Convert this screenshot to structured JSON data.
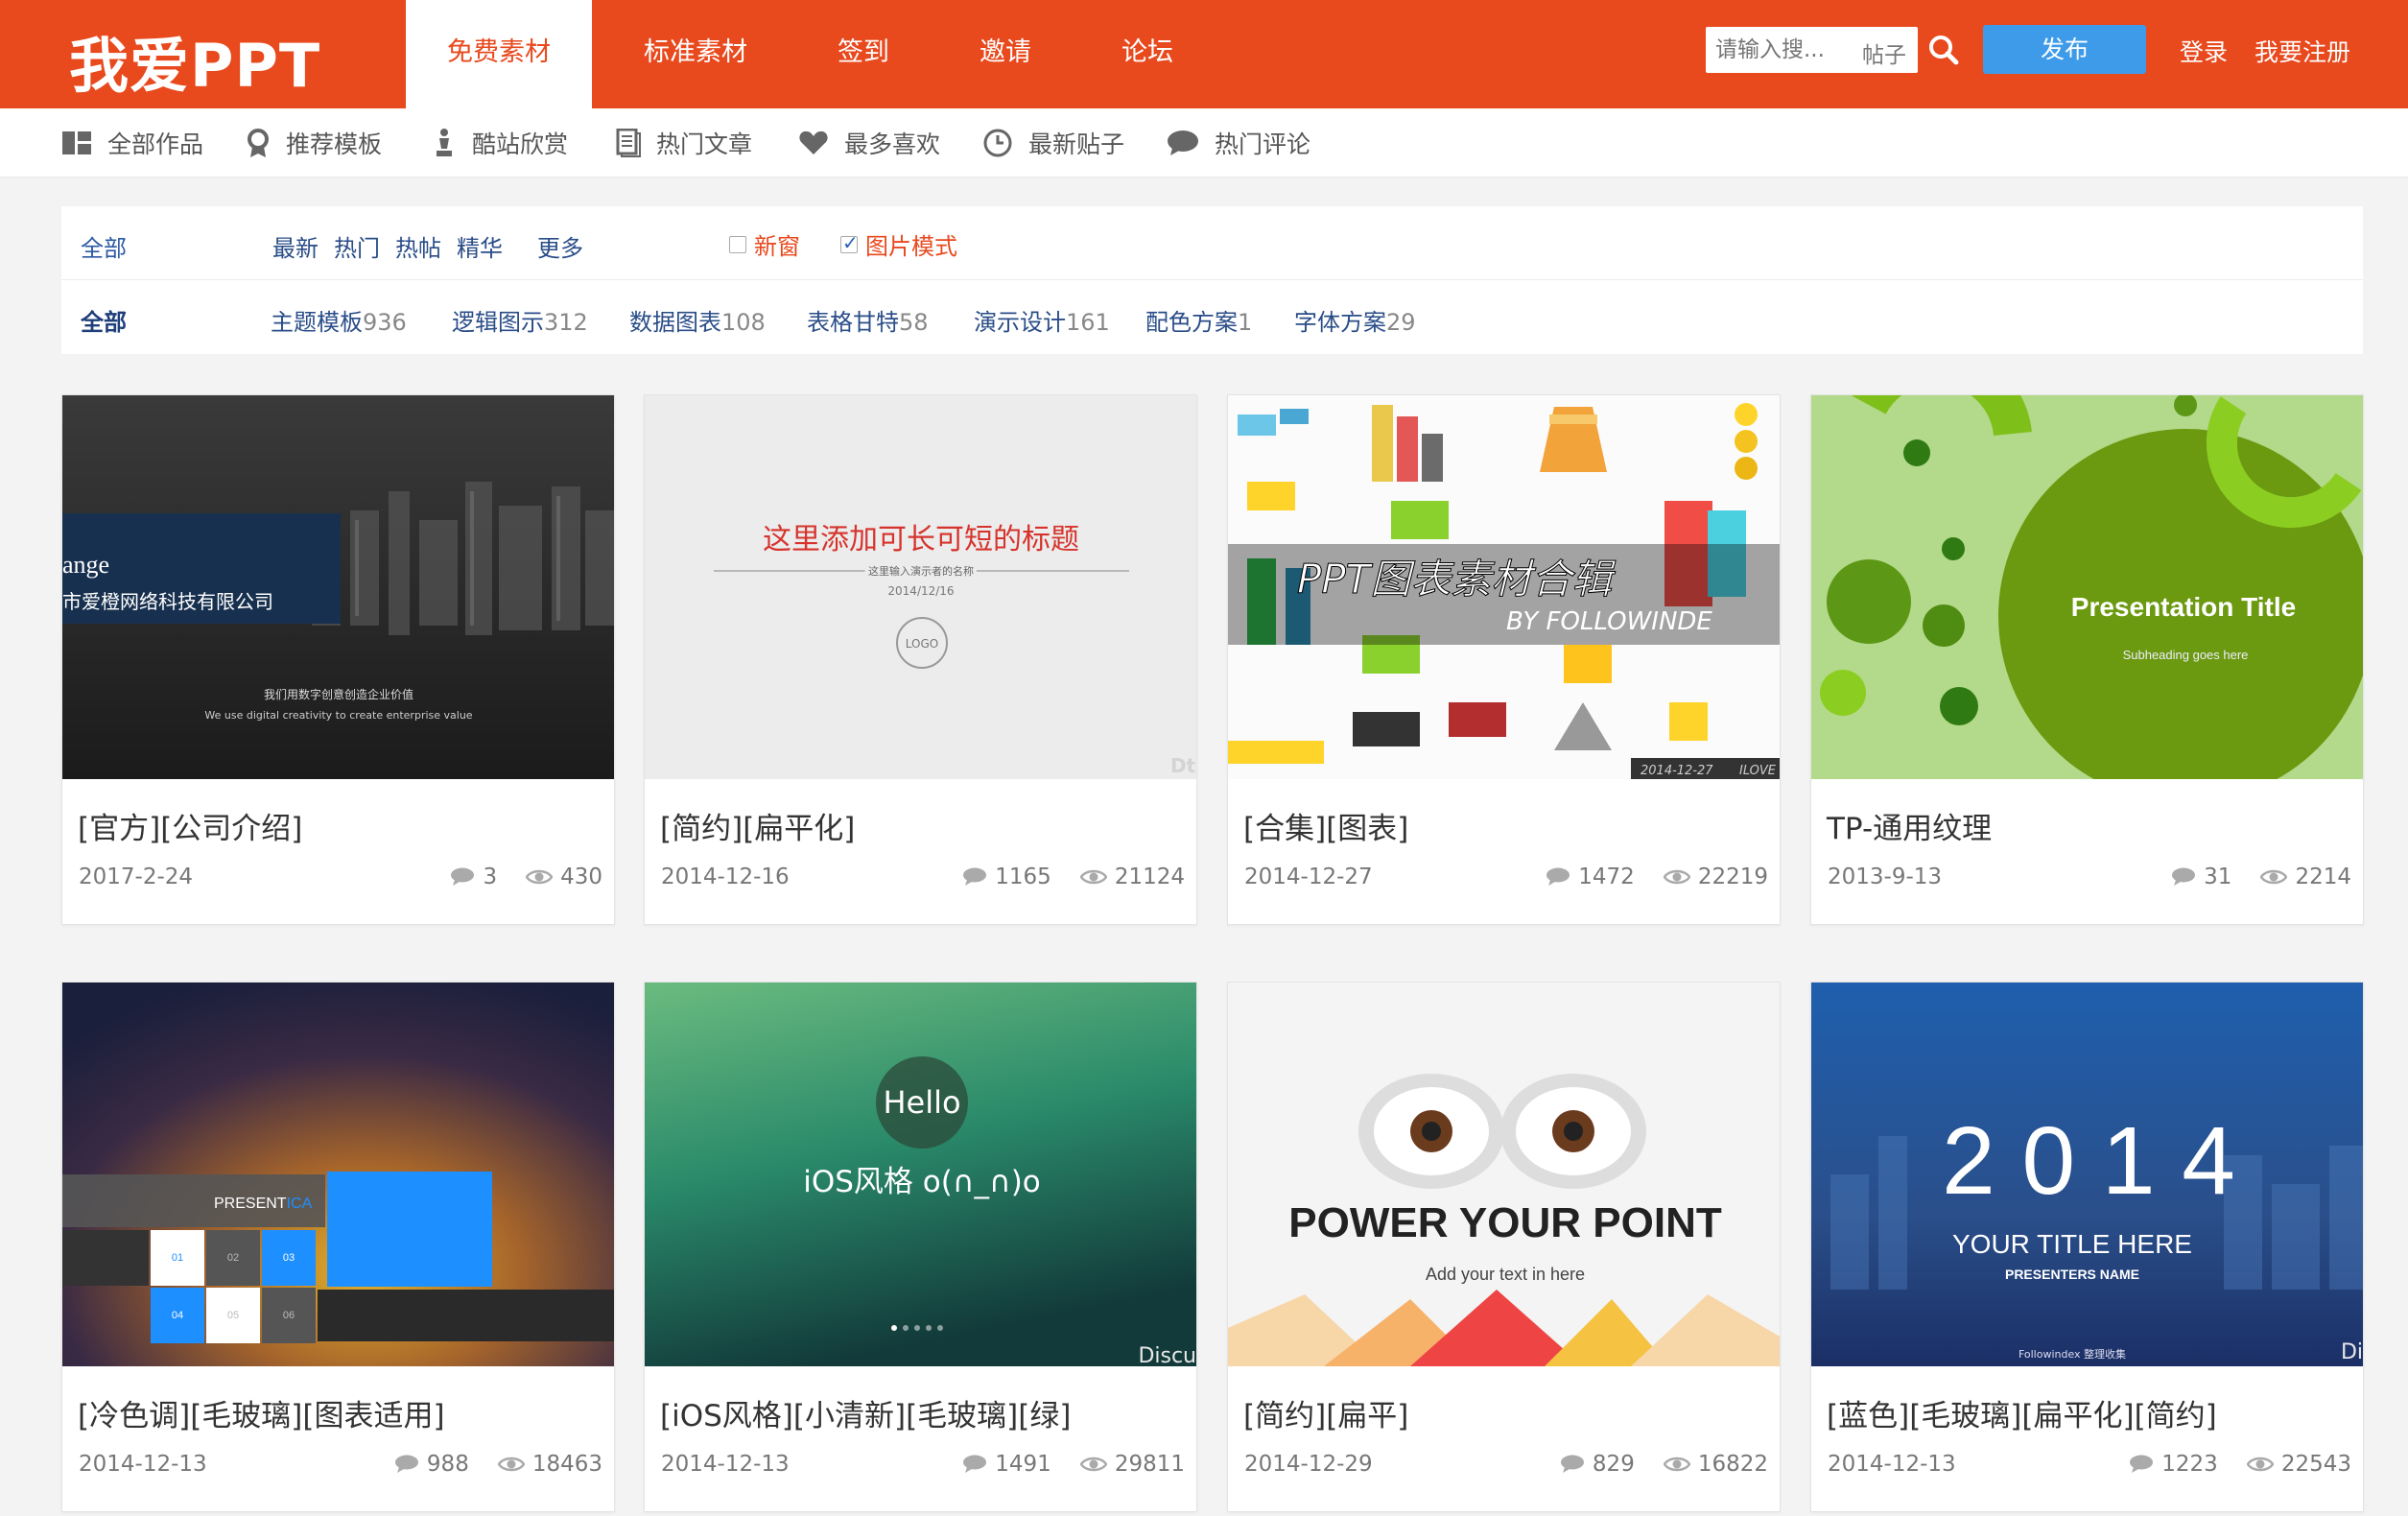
{
  "header": {
    "logo": "我爱PPT",
    "nav": [
      "免费素材",
      "标准素材",
      "签到",
      "邀请",
      "论坛"
    ],
    "search_placeholder": "请输入搜...",
    "search_scope": "帖子",
    "publish": "发布",
    "login": "登录",
    "register": "我要注册"
  },
  "subnav": [
    "全部作品",
    "推荐模板",
    "酷站欣赏",
    "热门文章",
    "最多喜欢",
    "最新贴子",
    "热门评论"
  ],
  "filter": {
    "row1": {
      "label": "全部",
      "links": [
        "最新",
        "热门",
        "热帖",
        "精华",
        "更多"
      ],
      "new_window": "新窗",
      "image_mode": "图片模式"
    },
    "row2": {
      "label": "全部",
      "categories": [
        {
          "name": "主题模板",
          "count": "936"
        },
        {
          "name": "逻辑图示",
          "count": "312"
        },
        {
          "name": "数据图表",
          "count": "108"
        },
        {
          "name": "表格甘特",
          "count": "58"
        },
        {
          "name": "演示设计",
          "count": "161"
        },
        {
          "name": "配色方案",
          "count": "1"
        },
        {
          "name": "字体方案",
          "count": "29"
        }
      ]
    }
  },
  "cards": [
    {
      "title": "[官方][公司介绍]",
      "date": "2017-2-24",
      "comments": "3",
      "views": "430",
      "thumb": {
        "t1": "ange",
        "t2": "市爱橙网络科技有限公司",
        "t3": "我们用数字创意创造企业价值",
        "t4": "We use digital creativity to create enterprise value"
      }
    },
    {
      "title": "[简约][扁平化]",
      "date": "2014-12-16",
      "comments": "1165",
      "views": "21124",
      "thumb": {
        "t1": "这里添加可长可短的标题",
        "t2": "这里输入演示者的名称",
        "t3": "2014/12/16",
        "t4": "LOGO",
        "t5": "Dt"
      }
    },
    {
      "title": "[合集][图表]",
      "date": "2014-12-27",
      "comments": "1472",
      "views": "22219",
      "thumb": {
        "t1": "PPT图表素材合辑",
        "t2": "BY FOLLOWINDE",
        "t3": "2014-12-27",
        "t4": "ILOVE"
      }
    },
    {
      "title": "TP-通用纹理",
      "date": "2013-9-13",
      "comments": "31",
      "views": "2214",
      "thumb": {
        "t1": "Presentation Title",
        "t2": "Subheading goes here"
      }
    },
    {
      "title": "[冷色调][毛玻璃][图表适用]",
      "date": "2014-12-13",
      "comments": "988",
      "views": "18463",
      "thumb": {
        "t1": "PRESENT",
        "t2": "ICA",
        "cells": [
          "01",
          "02",
          "03",
          "04",
          "05",
          "06"
        ]
      }
    },
    {
      "title": "[iOS风格][小清新][毛玻璃][绿]",
      "date": "2014-12-13",
      "comments": "1491",
      "views": "29811",
      "thumb": {
        "t1": "Hello",
        "t2": "iOS风格 o(∩_∩)o",
        "t3": "Discu"
      }
    },
    {
      "title": "[简约][扁平]",
      "date": "2014-12-29",
      "comments": "829",
      "views": "16822",
      "thumb": {
        "t1": "POWER YOUR POINT",
        "t2": "Add your text in here"
      }
    },
    {
      "title": "[蓝色][毛玻璃][扁平化][简约]",
      "date": "2014-12-13",
      "comments": "1223",
      "views": "22543",
      "thumb": {
        "t1": "2 0 1 4",
        "t2": "YOUR TITLE HERE",
        "t3": "PRESENTERS NAME",
        "t4": "Followindex 整理收集",
        "t5": "Di"
      }
    }
  ],
  "colors": {
    "brand": "#e8491d",
    "publish": "#3d9be9",
    "link": "#2a4d88"
  }
}
